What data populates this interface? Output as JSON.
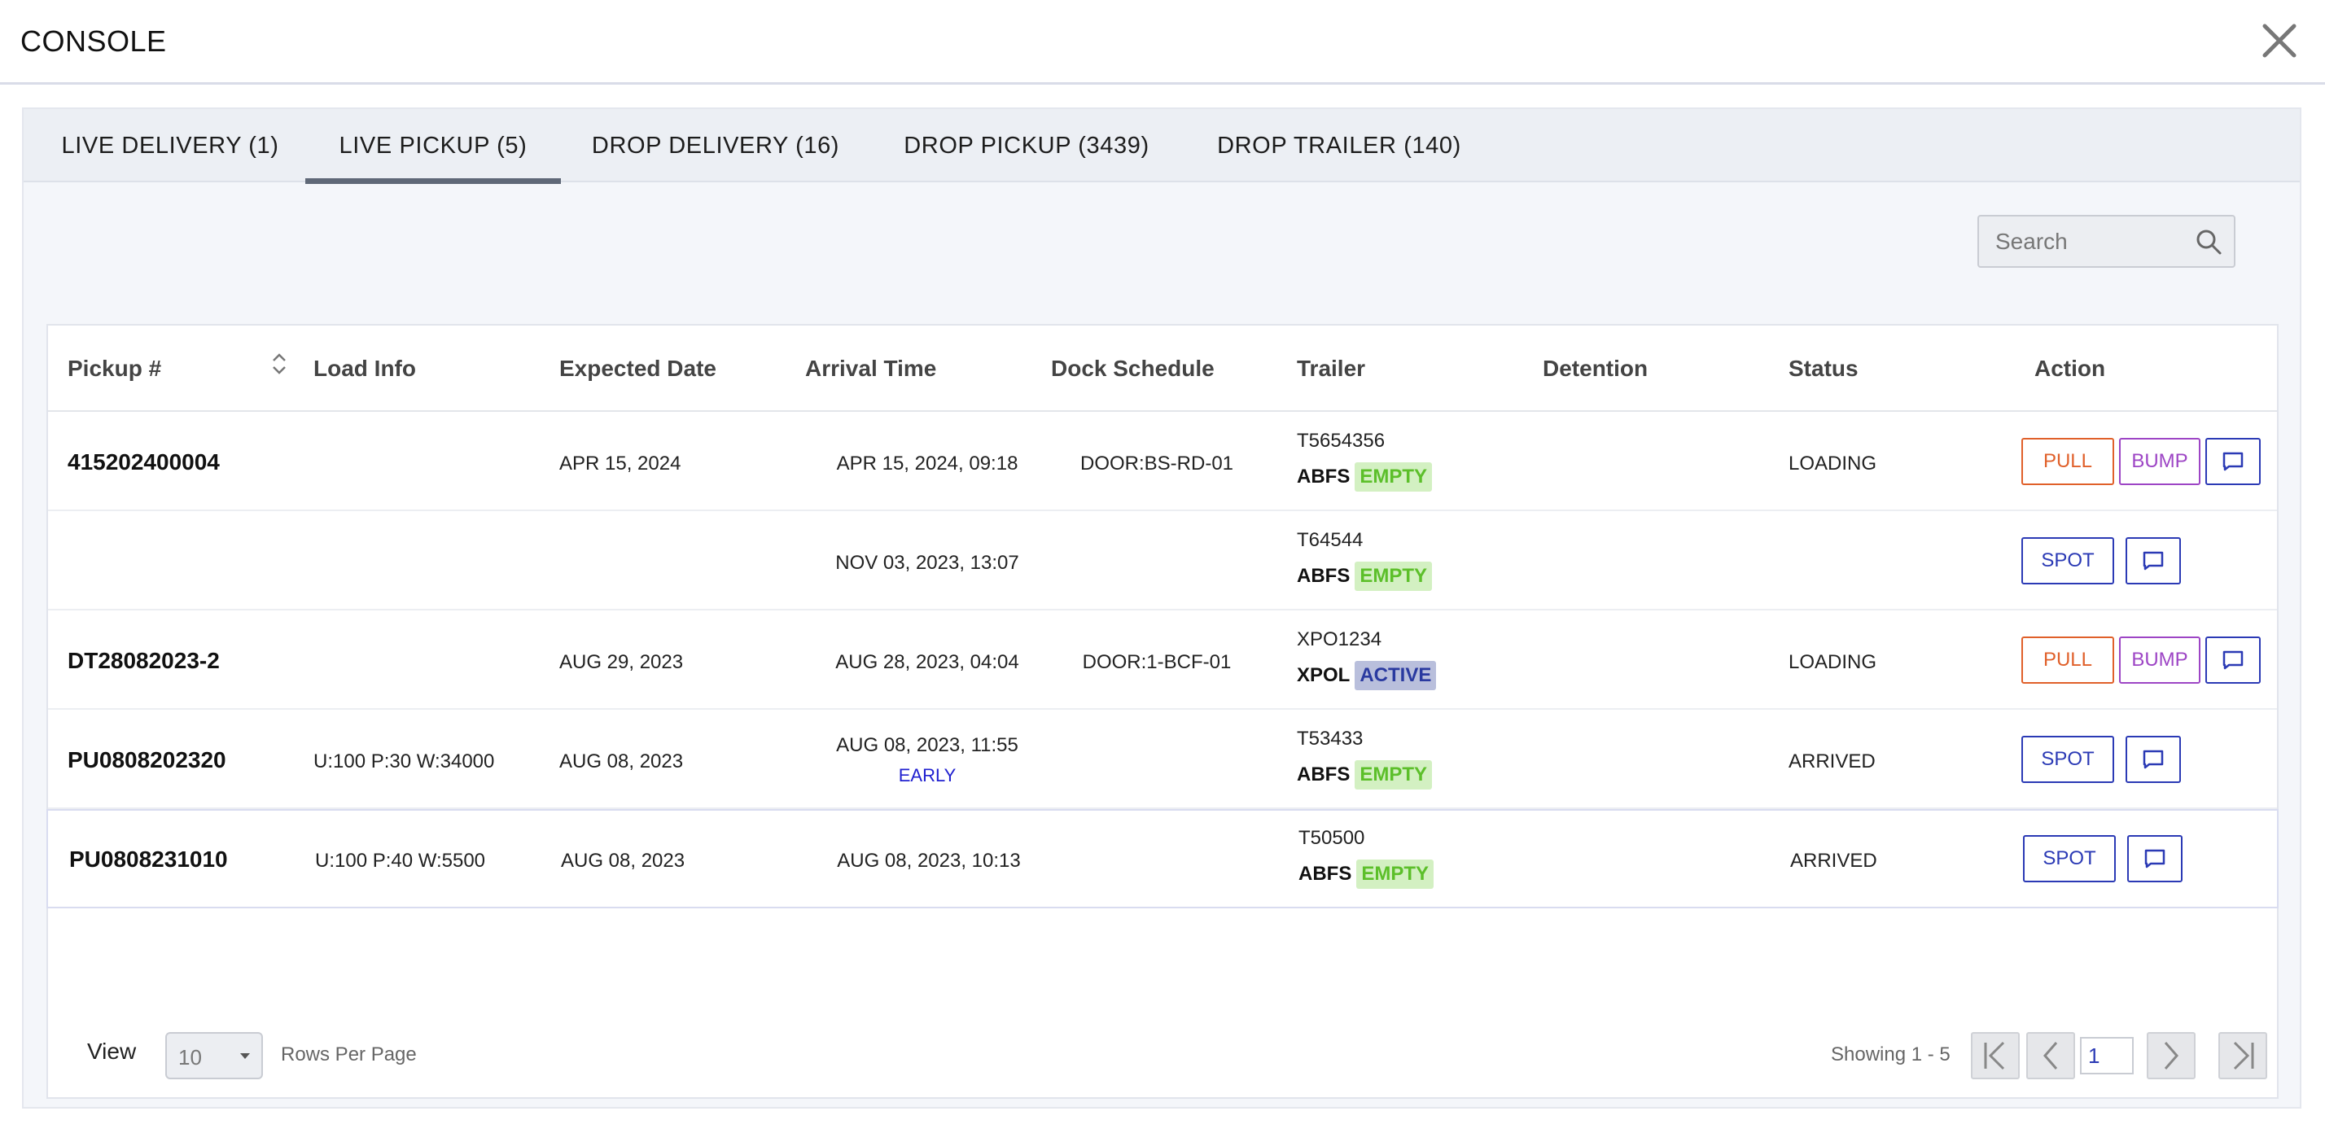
{
  "header": {
    "title": "CONSOLE"
  },
  "tabs": [
    {
      "label": "LIVE DELIVERY (1)",
      "active": false
    },
    {
      "label": "LIVE PICKUP (5)",
      "active": true
    },
    {
      "label": "DROP DELIVERY (16)",
      "active": false
    },
    {
      "label": "DROP PICKUP (3439)",
      "active": false
    },
    {
      "label": "DROP TRAILER (140)",
      "active": false
    }
  ],
  "search": {
    "placeholder": "Search"
  },
  "table": {
    "columns": [
      "Pickup #",
      "Load Info",
      "Expected Date",
      "Arrival Time",
      "Dock Schedule",
      "Trailer",
      "Detention",
      "Status",
      "Action"
    ],
    "rows": [
      {
        "pickup": "415202400004",
        "load_info": "",
        "expected_date": "APR 15, 2024",
        "arrival_time": "APR 15, 2024, 09:18",
        "arrival_note": "",
        "dock": "DOOR:BS-RD-01",
        "trailer_id": "T5654356",
        "carrier": "ABFS",
        "trailer_status": "EMPTY",
        "detention": "",
        "status": "LOADING",
        "actions": [
          "PULL",
          "BUMP"
        ]
      },
      {
        "pickup": "",
        "load_info": "",
        "expected_date": "",
        "arrival_time": "NOV 03, 2023, 13:07",
        "arrival_note": "",
        "dock": "",
        "trailer_id": "T64544",
        "carrier": "ABFS",
        "trailer_status": "EMPTY",
        "detention": "",
        "status": "",
        "actions": [
          "SPOT"
        ]
      },
      {
        "pickup": "DT28082023-2",
        "load_info": "",
        "expected_date": "AUG 29, 2023",
        "arrival_time": "AUG 28, 2023, 04:04",
        "arrival_note": "",
        "dock": "DOOR:1-BCF-01",
        "trailer_id": "XPO1234",
        "carrier": "XPOL",
        "trailer_status": "ACTIVE",
        "detention": "",
        "status": "LOADING",
        "actions": [
          "PULL",
          "BUMP"
        ]
      },
      {
        "pickup": "PU0808202320",
        "load_info": "U:100 P:30 W:34000",
        "expected_date": "AUG 08, 2023",
        "arrival_time": "AUG 08, 2023, 11:55",
        "arrival_note": "EARLY",
        "dock": "",
        "trailer_id": "T53433",
        "carrier": "ABFS",
        "trailer_status": "EMPTY",
        "detention": "",
        "status": "ARRIVED",
        "actions": [
          "SPOT"
        ]
      },
      {
        "pickup": "PU0808231010",
        "load_info": "U:100 P:40 W:5500",
        "expected_date": "AUG 08, 2023",
        "arrival_time": "AUG 08, 2023, 10:13",
        "arrival_note": "",
        "dock": "",
        "trailer_id": "T50500",
        "carrier": "ABFS",
        "trailer_status": "EMPTY",
        "detention": "",
        "status": "ARRIVED",
        "actions": [
          "SPOT"
        ]
      }
    ]
  },
  "pagination": {
    "view_label": "View",
    "rows_per_page": "10",
    "rows_per_page_label": "Rows Per Page",
    "showing": "Showing 1 - 5",
    "page": "1"
  },
  "colors": {
    "pull": "#e0602a",
    "bump": "#9d45c5",
    "spot": "#2b3ab5",
    "empty": "#5cbf2a",
    "active": "#2a3aa0"
  }
}
